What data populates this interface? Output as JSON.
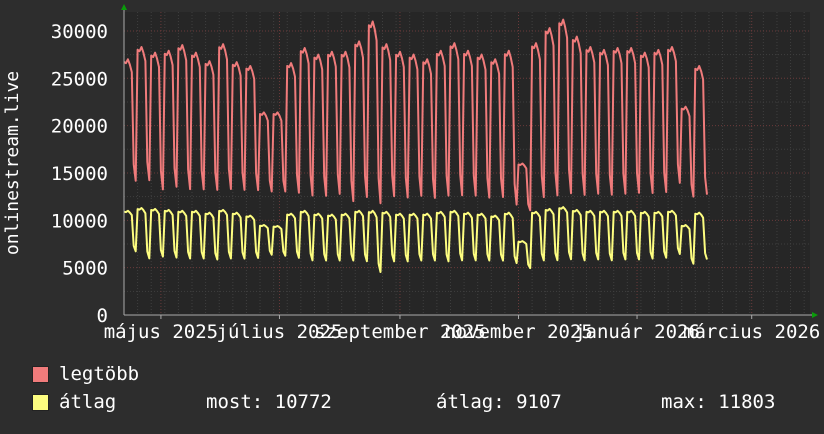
{
  "chart_data": {
    "type": "line",
    "ylabel": "onlinestream.live",
    "ylim": [
      0,
      32000
    ],
    "yticks": [
      0,
      5000,
      10000,
      15000,
      20000,
      25000,
      30000
    ],
    "xlim": [
      "2025-04-12",
      "2026-03-31"
    ],
    "xticks": [
      {
        "date": "2025-05-01",
        "label": "május 2025"
      },
      {
        "date": "2025-07-01",
        "label": "július 2025"
      },
      {
        "date": "2025-09-01",
        "label": "szeptember 2025"
      },
      {
        "date": "2025-11-01",
        "label": "november 2025"
      },
      {
        "date": "2026-01-01",
        "label": "január 2026"
      },
      {
        "date": "2026-03-01",
        "label": "március 2026"
      }
    ],
    "grid": true,
    "series": [
      {
        "name": "legtöbb",
        "color": "#f07b7b",
        "weekly_peak": [
          27000,
          28300,
          27700,
          27900,
          28500,
          27700,
          26800,
          28600,
          26700,
          26300,
          21400,
          21400,
          26600,
          28200,
          27500,
          27800,
          27800,
          28900,
          31000,
          28600,
          27800,
          27500,
          27000,
          27900,
          28700,
          27900,
          27500,
          27000,
          27900,
          16000,
          28700,
          30300,
          31200,
          29400,
          28300,
          28000,
          28200,
          28200,
          27700,
          28000,
          28300,
          22000,
          26300
        ],
        "weekly_low": [
          13500,
          13500,
          12500,
          12800,
          12500,
          12500,
          12500,
          12500,
          12500,
          12500,
          12600,
          12600,
          12200,
          11800,
          11800,
          12000,
          11200,
          11600,
          10800,
          11700,
          11600,
          11800,
          11600,
          11800,
          11800,
          11800,
          11600,
          11700,
          10800,
          10800,
          11600,
          11700,
          11900,
          11800,
          12000,
          11900,
          12000,
          12100,
          12100,
          12200,
          13200,
          12000,
          12000
        ]
      },
      {
        "name": "átlag",
        "color": "#fdfd80",
        "weekly_peak": [
          11000,
          11300,
          11200,
          11100,
          11000,
          11000,
          10800,
          11100,
          10800,
          10500,
          9500,
          9400,
          10700,
          11000,
          10700,
          10600,
          10700,
          11000,
          11000,
          10900,
          10700,
          10700,
          10700,
          10900,
          11000,
          10800,
          10700,
          10500,
          10800,
          7800,
          10900,
          11200,
          11400,
          11100,
          11000,
          11000,
          11000,
          11000,
          10900,
          10900,
          11000,
          9500,
          10800
        ],
        "weekly_low": [
          6500,
          5700,
          5900,
          5800,
          5700,
          5700,
          5600,
          5700,
          5700,
          5800,
          6200,
          6100,
          5800,
          5500,
          5500,
          5500,
          5500,
          5400,
          4200,
          5400,
          5400,
          5500,
          5500,
          5400,
          5500,
          5500,
          5500,
          5500,
          5200,
          4800,
          5500,
          5500,
          5600,
          5500,
          5600,
          5500,
          5600,
          5600,
          5700,
          5800,
          6200,
          5200,
          5600
        ]
      }
    ]
  },
  "legend": {
    "max_label": "legtöbb",
    "avg_label": "átlag",
    "stat_now": "most: 10772",
    "stat_avg": "átlag: 9107",
    "stat_max": "max: 11803"
  },
  "colors": {
    "background": "#2d2d2d",
    "plot_background": "#262626",
    "grid_major": "#6a3a3a",
    "grid_minor": "#3f3f3f",
    "axis_arrow": "#0a9b0a",
    "text": "#ffffff"
  }
}
